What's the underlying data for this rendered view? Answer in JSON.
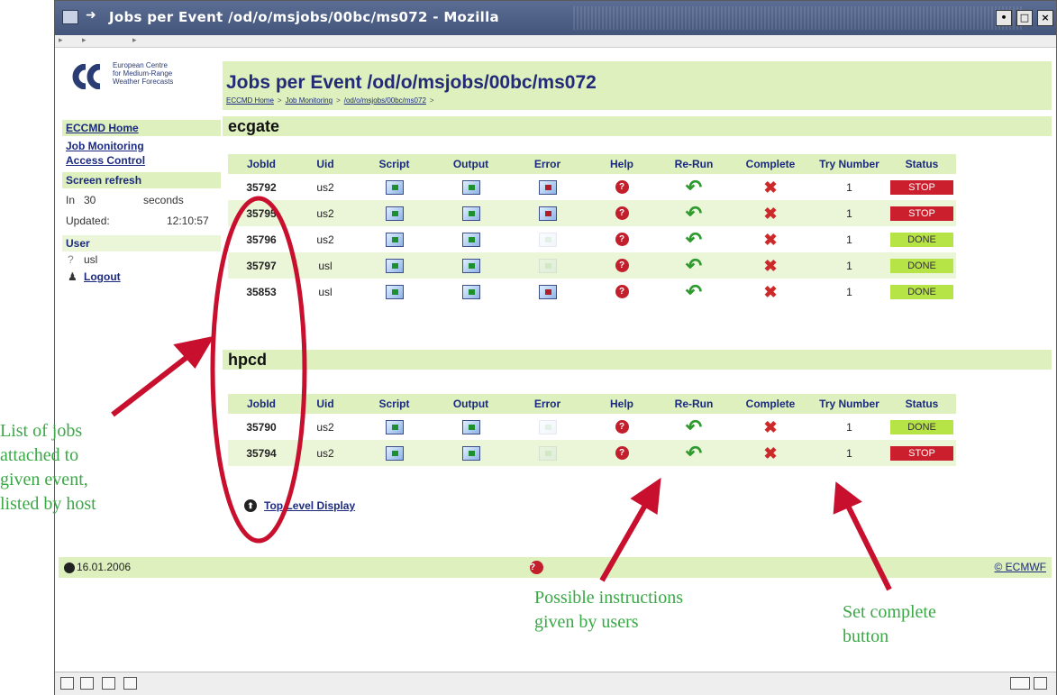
{
  "window": {
    "title": "Jobs per Event /od/o/msjobs/00bc/ms072 - Mozilla",
    "controls": [
      "•",
      "□",
      "×"
    ]
  },
  "logo": {
    "line1": "European Centre",
    "line2": "for Medium-Range",
    "line3": "Weather Forecasts"
  },
  "page": {
    "title": "Jobs per Event /od/o/msjobs/00bc/ms072",
    "breadcrumb": [
      "ECCMD Home",
      "Job Monitoring",
      "/od/o/msjobs/00bc/ms072"
    ],
    "breadcrumb_sep": ">"
  },
  "sidebar": {
    "home": "ECCMD Home",
    "job_monitoring": "Job Monitoring",
    "access_control": "Access Control",
    "refresh_title": "Screen refresh",
    "refresh_in": "In",
    "refresh_seconds_value": "30",
    "refresh_seconds_label": "seconds",
    "updated_label": "Updated:",
    "updated_time": "12:10:57",
    "user_title": "User",
    "user_name": "usl",
    "logout": "Logout"
  },
  "columns": [
    "JobId",
    "Uid",
    "Script",
    "Output",
    "Error",
    "Help",
    "Re-Run",
    "Complete",
    "Try Number",
    "Status"
  ],
  "hosts": [
    {
      "name": "ecgate",
      "jobs": [
        {
          "jobid": "35792",
          "uid": "us2",
          "error": true,
          "try": "1",
          "status": "STOP"
        },
        {
          "jobid": "35795",
          "uid": "us2",
          "error": true,
          "try": "1",
          "status": "STOP"
        },
        {
          "jobid": "35796",
          "uid": "us2",
          "error": false,
          "try": "1",
          "status": "DONE"
        },
        {
          "jobid": "35797",
          "uid": "usl",
          "error": false,
          "try": "1",
          "status": "DONE"
        },
        {
          "jobid": "35853",
          "uid": "usl",
          "error": true,
          "try": "1",
          "status": "DONE"
        }
      ]
    },
    {
      "name": "hpcd",
      "jobs": [
        {
          "jobid": "35790",
          "uid": "us2",
          "error": false,
          "try": "1",
          "status": "DONE"
        },
        {
          "jobid": "35794",
          "uid": "us2",
          "error": false,
          "try": "1",
          "status": "STOP"
        }
      ]
    }
  ],
  "top_level": "Top Level Display",
  "footer": {
    "date": "16.01.2006",
    "copyright": "© ECMWF"
  },
  "annotations": {
    "left": [
      "List of jobs",
      "attached to",
      "given event,",
      "listed by host"
    ],
    "middle": [
      "Possible instructions",
      "given by users"
    ],
    "right": [
      "Set complete",
      "button"
    ]
  },
  "colors": {
    "header_green": "#ddf0bd",
    "stop_red": "#cc1f2d",
    "done_green": "#b6e346",
    "title_blue": "#232a78",
    "annotation_green": "#3aa846",
    "arrow_red": "#c8102e"
  }
}
